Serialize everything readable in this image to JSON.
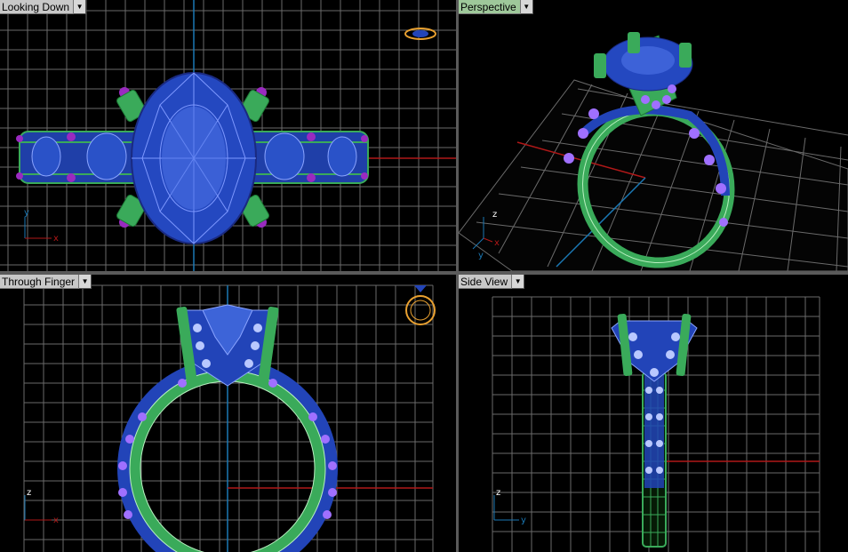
{
  "viewports": [
    {
      "title": "Looking Down",
      "active": false
    },
    {
      "title": "Perspective",
      "active": true
    },
    {
      "title": "Through Finger",
      "active": false
    },
    {
      "title": "Side View",
      "active": false
    }
  ],
  "axes": {
    "looking_down": {
      "vertical": "y",
      "horizontal": "x"
    },
    "perspective": {
      "vertical": "z",
      "horizontal": "x",
      "depth": "y"
    },
    "through_finger": {
      "vertical": "z",
      "horizontal": "x"
    },
    "side_view": {
      "vertical": "z",
      "horizontal": "y"
    }
  },
  "colors": {
    "grid": "#6a6a6a",
    "x_axis": "#b01818",
    "y_axis": "#1a78b4",
    "gem": "#2244b8",
    "gem_light": "#8aa4ff",
    "metal": "#3aaa5a",
    "accent_stones": "#a070ff",
    "prongs_purple": "#9a2ac0",
    "preview_orange": "#e8a030",
    "active_tab": "#9ec89a"
  },
  "dropdown_icon": "chevron-down-icon"
}
